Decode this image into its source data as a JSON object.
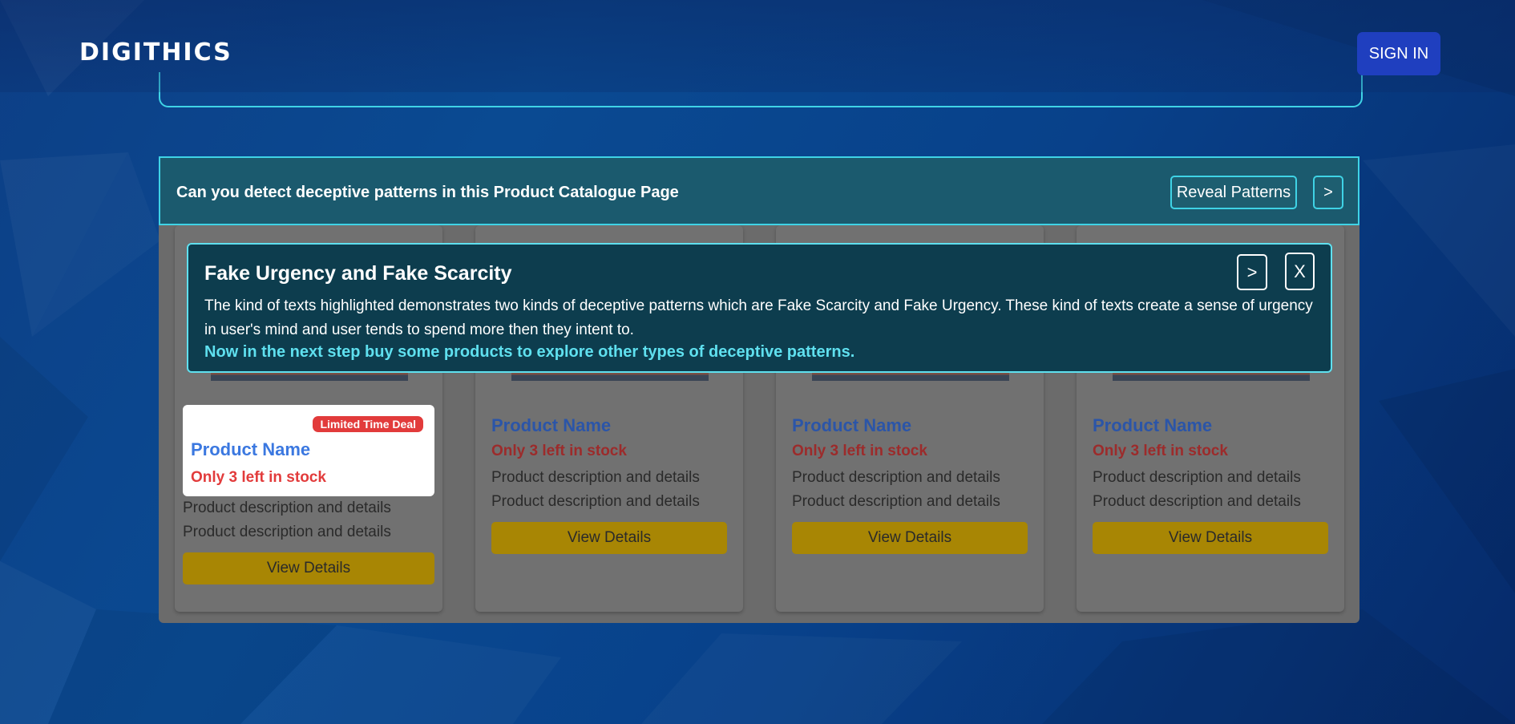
{
  "header": {
    "logo_text": "DIGITHICS",
    "signin_label": "SIGN IN"
  },
  "challenge": {
    "title": "Can you detect deceptive patterns in this Product Catalogue Page",
    "reveal_label": "Reveal Patterns",
    "next_label": ">"
  },
  "tooltip": {
    "title": "Fake Urgency and Fake Scarcity",
    "body": "The kind of texts highlighted demonstrates two kinds of deceptive patterns which are Fake Scarcity and Fake Urgency. These kind of texts create a sense of urgency in user's mind and user tends to spend more then they intent to.",
    "cta": "Now in the next step buy some products to explore other types of deceptive patterns.",
    "next_label": ">",
    "close_label": "X"
  },
  "products": [
    {
      "badge": "Limited Time Deal",
      "name": "Product Name",
      "stock": "Only 3 left in stock",
      "desc1": "Product description and details",
      "desc2": "Product description and details",
      "button": "View Details"
    },
    {
      "name": "Product Name",
      "stock": "Only 3 left in stock",
      "desc1": "Product description and details",
      "desc2": "Product description and details",
      "button": "View Details"
    },
    {
      "name": "Product Name",
      "stock": "Only 3 left in stock",
      "desc1": "Product description and details",
      "desc2": "Product description and details",
      "button": "View Details"
    },
    {
      "name": "Product Name",
      "stock": "Only 3 left in stock",
      "desc1": "Product description and details",
      "desc2": "Product description and details",
      "button": "View Details"
    }
  ],
  "colors": {
    "accent_cyan": "#3fd3e6",
    "signin_blue": "#1f3fbf",
    "urgency_red": "#e23b3b",
    "button_yellow": "#f0c20a"
  }
}
